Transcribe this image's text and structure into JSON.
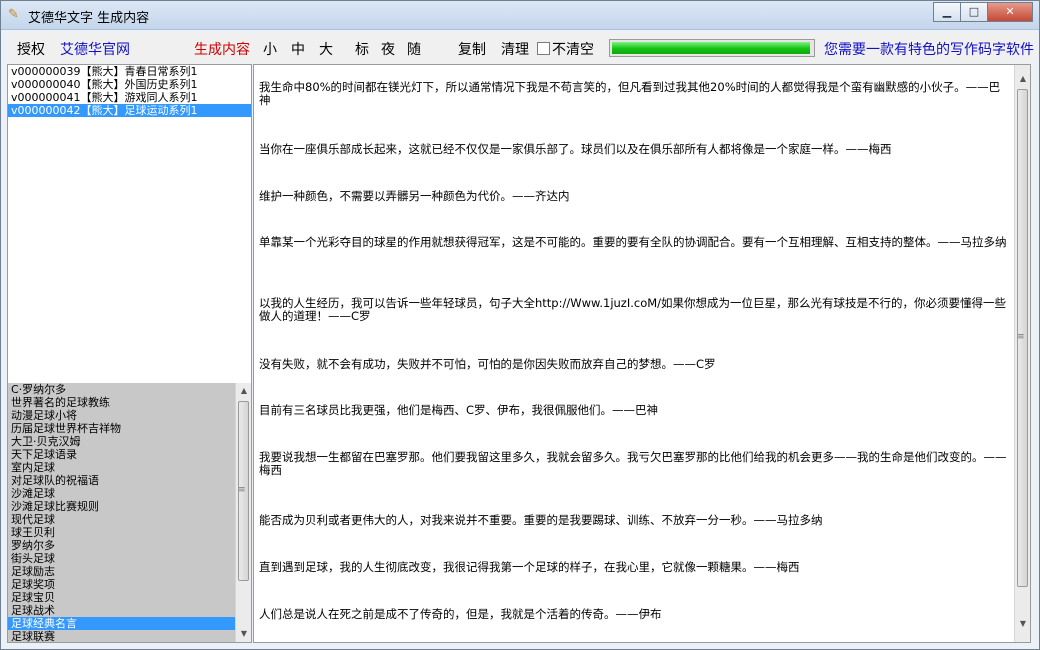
{
  "window": {
    "title": "艾德华文字 生成内容",
    "controls": {
      "minimize": "▁",
      "maximize": "□",
      "close": "✕"
    }
  },
  "toolbar": {
    "authorize": "授权",
    "official_site": "艾德华官网",
    "generate": "生成内容",
    "size_small": "小",
    "size_medium": "中",
    "size_large": "大",
    "theme_standard": "标",
    "theme_night": "夜",
    "theme_random": "随",
    "copy": "复制",
    "clear": "清理",
    "no_clear_checkbox": "不清空",
    "no_clear_checked": false,
    "progress_fraction": 0.99,
    "promo": "您需要一款有特色的写作码字软件"
  },
  "series_list": [
    {
      "text": "v000000039【熊大】青春日常系列1",
      "selected": false
    },
    {
      "text": "v000000040【熊大】外国历史系列1",
      "selected": false
    },
    {
      "text": "v000000041【熊大】游戏同人系列1",
      "selected": false
    },
    {
      "text": "v000000042【熊大】足球运动系列1",
      "selected": true
    }
  ],
  "topic_list": [
    {
      "text": "C·罗纳尔多",
      "selected": false
    },
    {
      "text": "世界著名的足球教练",
      "selected": false
    },
    {
      "text": "动漫足球小将",
      "selected": false
    },
    {
      "text": "历届足球世界杯吉祥物",
      "selected": false
    },
    {
      "text": "大卫·贝克汉姆",
      "selected": false
    },
    {
      "text": "天下足球语录",
      "selected": false
    },
    {
      "text": "室内足球",
      "selected": false
    },
    {
      "text": "对足球队的祝福语",
      "selected": false
    },
    {
      "text": "沙滩足球",
      "selected": false
    },
    {
      "text": "沙滩足球比赛规则",
      "selected": false
    },
    {
      "text": "现代足球",
      "selected": false
    },
    {
      "text": "球王贝利",
      "selected": false
    },
    {
      "text": "罗纳尔多",
      "selected": false
    },
    {
      "text": "街头足球",
      "selected": false
    },
    {
      "text": "足球励志",
      "selected": false
    },
    {
      "text": "足球奖项",
      "selected": false
    },
    {
      "text": "足球宝贝",
      "selected": false
    },
    {
      "text": "足球战术",
      "selected": false
    },
    {
      "text": "足球经典名言",
      "selected": true
    },
    {
      "text": "足球联赛",
      "selected": false
    }
  ],
  "paragraphs": [
    "我生命中80%的时间都在镁光灯下，所以通常情况下我是不苟言笑的，但凡看到过我其他20%时间的人都觉得我是个蛮有幽默感的小伙子。——巴神",
    "当你在一座俱乐部成长起来，这就已经不仅仅是一家俱乐部了。球员们以及在俱乐部所有人都将像是一个家庭一样。——梅西",
    "维护一种颜色，不需要以弄髒另一种颜色为代价。——齐达内",
    "单靠某一个光彩夺目的球星的作用就想获得冠军，这是不可能的。重要的要有全队的协调配合。要有一个互相理解、互相支持的整体。——马拉多纳",
    "以我的人生经历，我可以告诉一些年轻球员，句子大全http://Www.1juzI.coM/如果你想成为一位巨星，那么光有球技是不行的，你必须要懂得一些做人的道理！——C罗",
    "没有失败，就不会有成功，失败并不可怕，可怕的是你因失败而放弃自己的梦想。——C罗",
    "目前有三名球员比我更强，他们是梅西、C罗、伊布，我很佩服他们。——巴神",
    "我要说我想一生都留在巴塞罗那。他们要我留这里多久，我就会留多久。我亏欠巴塞罗那的比他们给我的机会更多——我的生命是他们改变的。——梅西",
    "能否成为贝利或者更伟大的人，对我来说并不重要。重要的是我要踢球、训练、不放弃一分一秒。——马拉多纳",
    "直到遇到足球，我的人生彻底改变，我很记得我第一个足球的样子，在我心里，它就像一颗糖果。——梅西",
    "人们总是说人在死之前是成不了传奇的，但是，我就是个活着的传奇。——伊布"
  ]
}
